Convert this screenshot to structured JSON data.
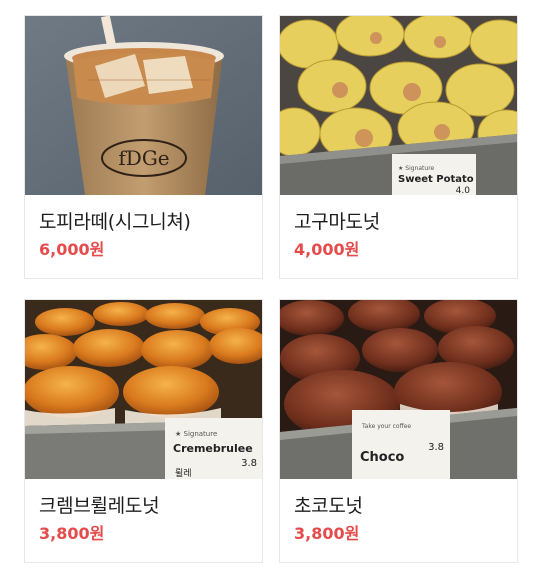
{
  "products": [
    {
      "name": "도피라떼(시그니쳐)",
      "price": "6,000원",
      "image": "coffee-cup-photo",
      "cup_logo": "fDGe"
    },
    {
      "name": "고구마도넛",
      "price": "4,000원",
      "image": "sweet-potato-donut-photo",
      "sign_sub": "★ Signature",
      "sign_name": "Sweet Potato",
      "sign_price": "4.0"
    },
    {
      "name": "크렘브륄레도넛",
      "price": "3,800원",
      "image": "cremebrulee-donut-photo",
      "sign_sub": "★ Signature",
      "sign_name": "Cremebrulee",
      "sign_price": "3.8",
      "sign_korean": "륄레"
    },
    {
      "name": "초코도넛",
      "price": "3,800원",
      "image": "choco-donut-photo",
      "sign_top": "Take your coffee",
      "sign_name": "Choco",
      "sign_price": "3.8"
    }
  ]
}
